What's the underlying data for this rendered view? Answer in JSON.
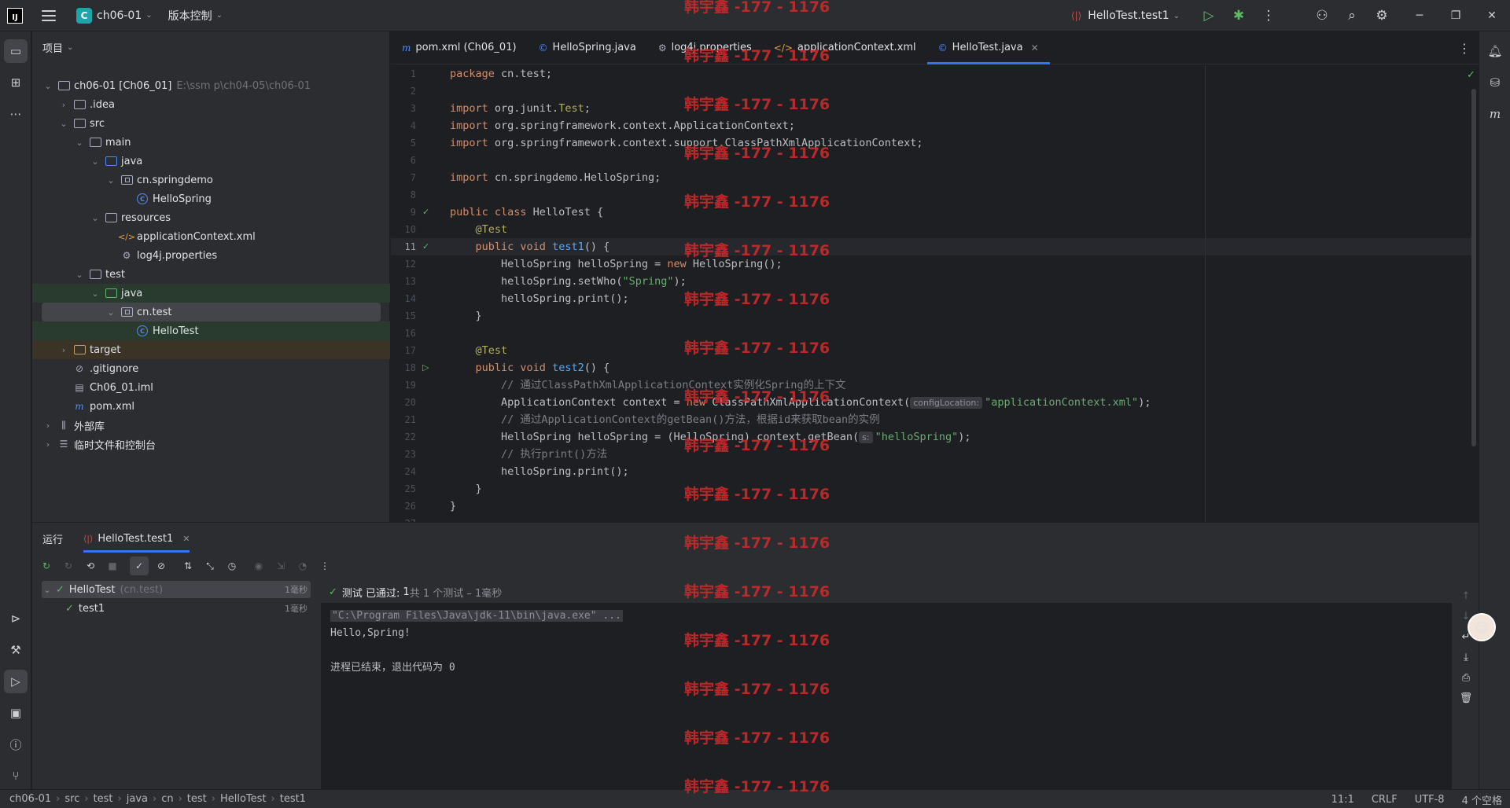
{
  "titlebar": {
    "project_badge": "C",
    "project_name": "ch06-01",
    "vcs": "版本控制",
    "run_config": "HelloTest.test1"
  },
  "project_panel": {
    "title": "项目",
    "tree": [
      {
        "label": "ch06-01 [Ch06_01]",
        "path": "E:\\ssm p\\ch04-05\\ch06-01",
        "level": 0,
        "open": true,
        "icon": "module-folder-icon"
      },
      {
        "label": ".idea",
        "level": 1,
        "open": false,
        "icon": "folder-icon"
      },
      {
        "label": "src",
        "level": 1,
        "open": true,
        "icon": "folder-icon"
      },
      {
        "label": "main",
        "level": 2,
        "open": true,
        "icon": "folder-icon"
      },
      {
        "label": "java",
        "level": 3,
        "open": true,
        "icon": "source-folder-icon"
      },
      {
        "label": "cn.springdemo",
        "level": 4,
        "open": true,
        "icon": "package-icon"
      },
      {
        "label": "HelloSpring",
        "level": 5,
        "icon": "class-icon"
      },
      {
        "label": "resources",
        "level": 3,
        "open": true,
        "icon": "resources-folder-icon"
      },
      {
        "label": "applicationContext.xml",
        "level": 4,
        "icon": "xml-file-icon"
      },
      {
        "label": "log4j.properties",
        "level": 4,
        "icon": "properties-file-icon"
      },
      {
        "label": "test",
        "level": 2,
        "open": true,
        "icon": "folder-icon"
      },
      {
        "label": "java",
        "level": 3,
        "open": true,
        "icon": "test-folder-icon"
      },
      {
        "label": "cn.test",
        "level": 4,
        "open": true,
        "icon": "package-icon"
      },
      {
        "label": "HelloTest",
        "level": 5,
        "icon": "class-icon"
      },
      {
        "label": "target",
        "level": 1,
        "open": false,
        "icon": "excluded-folder-icon"
      },
      {
        "label": ".gitignore",
        "level": 1,
        "icon": "gitignore-file-icon"
      },
      {
        "label": "Ch06_01.iml",
        "level": 1,
        "icon": "iml-file-icon"
      },
      {
        "label": "pom.xml",
        "level": 1,
        "icon": "maven-file-icon"
      },
      {
        "label": "外部库",
        "level": 0,
        "open": false,
        "icon": "library-icon"
      },
      {
        "label": "临时文件和控制台",
        "level": 0,
        "open": false,
        "icon": "scratches-icon"
      }
    ]
  },
  "tabs": [
    {
      "label": "pom.xml (Ch06_01)",
      "icon": "maven-file-icon",
      "glyph": "m"
    },
    {
      "label": "HelloSpring.java",
      "icon": "class-icon",
      "glyph": "©"
    },
    {
      "label": "log4j.properties",
      "icon": "properties-file-icon",
      "glyph": "⚙"
    },
    {
      "label": "applicationContext.xml",
      "icon": "xml-file-icon",
      "glyph": "</>"
    },
    {
      "label": "HelloTest.java",
      "icon": "class-icon",
      "glyph": "©"
    }
  ],
  "editor": {
    "current_line": 11,
    "line_count": 27,
    "inlay_config_location": "configLocation:",
    "inlay_s": "s:"
  },
  "run_panel": {
    "tab_title": "运行",
    "run_tab": "HelloTest.test1",
    "status_prefix": "测试 已通过:",
    "status_count": "1",
    "status_suffix": "共 1 个测试 – 1毫秒",
    "tests": [
      {
        "name": "HelloTest",
        "pkg": "(cn.test)",
        "duration": "1毫秒"
      },
      {
        "name": "test1",
        "pkg": "",
        "duration": "1毫秒"
      }
    ],
    "console": [
      "\"C:\\Program Files\\Java\\jdk-11\\bin\\java.exe\" ...",
      "Hello,Spring!",
      "",
      "进程已结束，退出代码为 0"
    ]
  },
  "statusbar": {
    "breadcrumbs": [
      "ch06-01",
      "src",
      "test",
      "java",
      "cn",
      "test",
      "HelloTest",
      "test1"
    ],
    "position": "11:1",
    "line_sep": "CRLF",
    "encoding": "UTF-8",
    "indent": "4 个空格"
  },
  "watermark": "韩宇鑫 -177 - 1176",
  "colors": {
    "accent": "#3574f0",
    "pass": "#5fb865",
    "watermark": "#c92b2b"
  }
}
